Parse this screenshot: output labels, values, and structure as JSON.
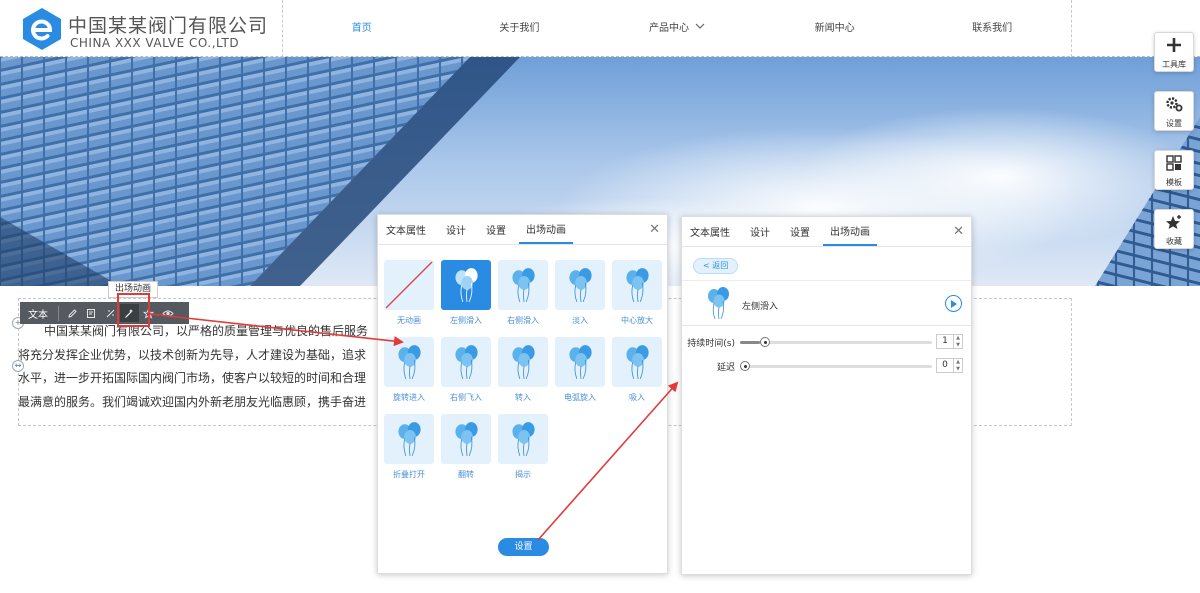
{
  "header": {
    "logo_cn": "中国某某阀门有限公司",
    "logo_en": "CHINA XXX VALVE CO.,LTD",
    "nav": [
      {
        "label": "首页",
        "active": true
      },
      {
        "label": "关于我们"
      },
      {
        "label": "产品中心",
        "has_dropdown": true
      },
      {
        "label": "新闻中心"
      },
      {
        "label": "联系我们"
      }
    ]
  },
  "content": {
    "lines": [
      "中国某某阀门有限公司，以严格的质量管理与优良的售后服务",
      "将充分发挥企业优势，以技术创新为先导，人才建设为基础，追求",
      "水平，进一步开拓国际国内阀门市场，使客户以较短的时间和合理",
      "最满意的服务。我们竭诚欢迎国内外新老朋友光临惠顾，携手奋进"
    ]
  },
  "text_toolbar": {
    "label": "文本",
    "tooltip": "出场动画",
    "icons": [
      "edit-icon",
      "style-icon",
      "link-icon",
      "animation-icon",
      "star-icon",
      "eye-icon"
    ]
  },
  "panel1": {
    "tabs": [
      "文本属性",
      "设计",
      "设置",
      "出场动画"
    ],
    "active_tab": 3,
    "animations": [
      "无动画",
      "左侧滑入",
      "右侧滑入",
      "淡入",
      "中心放大",
      "旋转进入",
      "右侧飞入",
      "转入",
      "电弧旋入",
      "吸入",
      "折叠打开",
      "翻转",
      "揭示"
    ],
    "selected_animation": 1,
    "settings_button": "设置"
  },
  "panel2": {
    "tabs": [
      "文本属性",
      "设计",
      "设置",
      "出场动画"
    ],
    "active_tab": 3,
    "back_label": "< 返回",
    "animation_name": "左侧滑入",
    "duration_label": "持续时间(s)",
    "duration_value": "1",
    "delay_label": "延迟",
    "delay_value": "0",
    "duration_level": 0.1,
    "delay_level": 0.0
  },
  "tools": [
    {
      "label": "工具库",
      "icon": "plus-icon"
    },
    {
      "label": "设置",
      "icon": "gear-icon"
    },
    {
      "label": "模板",
      "icon": "template-icon"
    },
    {
      "label": "收藏",
      "icon": "star-add-icon"
    }
  ],
  "colors": {
    "accent": "#2a8be3",
    "tile_bg": "#e3f1fd",
    "annotation": "#e23a3a",
    "toolbar_bg": "#555a60"
  }
}
